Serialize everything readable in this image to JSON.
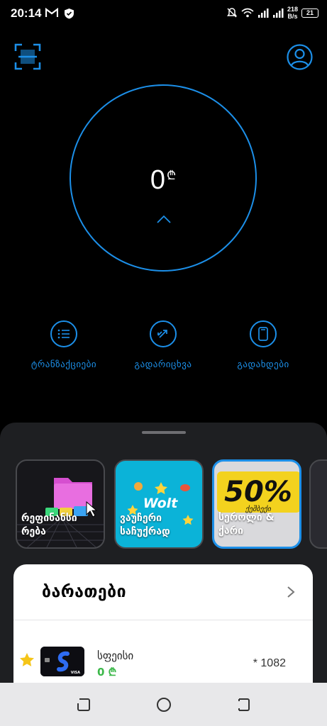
{
  "status_bar": {
    "time": "20:14",
    "speed_value": "218",
    "speed_unit": "B/s",
    "battery": "21",
    "icons": [
      "gmail-icon",
      "shield-icon",
      "mute-icon",
      "wifi-icon",
      "signal-icon",
      "signal-icon",
      "battery-icon"
    ]
  },
  "header": {
    "scan_icon": "scan-icon",
    "profile_icon": "profile-icon"
  },
  "balance": {
    "amount": "0",
    "currency": "₾"
  },
  "actions": [
    {
      "label": "ტრანზაქციები",
      "icon": "list-icon"
    },
    {
      "label": "გადარიცხვა",
      "icon": "transfer-icon"
    },
    {
      "label": "გადახდები",
      "icon": "phone-icon"
    }
  ],
  "promos": [
    {
      "text_line1": "რეფინანსი",
      "text_line2": "რება"
    },
    {
      "text_line1": "ვაუჩერი",
      "text_line2": "საჩუქრად",
      "brand": "Wolt"
    },
    {
      "text_line1": "სეროლი &",
      "text_line2": "ქარი",
      "badge": "50%",
      "badge_sub": "ქეშბექი"
    }
  ],
  "cards": {
    "title": "ბარათები",
    "items": [
      {
        "name": "სფეისი",
        "balance": "0 ₾",
        "number": "* 1082",
        "favorite": true,
        "brand": "VISA"
      }
    ]
  },
  "colors": {
    "accent": "#1c8fe8",
    "background": "#000000",
    "sheet": "#1e1f22",
    "balance_green": "#3cb84a",
    "star": "#f5c518"
  }
}
